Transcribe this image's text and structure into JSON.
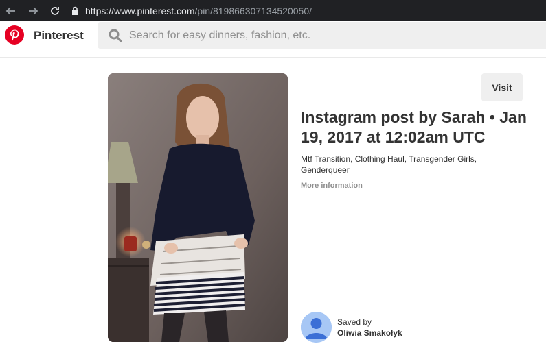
{
  "browser": {
    "url_host": "https://www.pinterest.com",
    "url_path": "/pin/819866307134520050/"
  },
  "header": {
    "brand": "Pinterest",
    "search_placeholder": "Search for easy dinners, fashion, etc."
  },
  "pin": {
    "visit_label": "Visit",
    "title": "Instagram post by Sarah • Jan 19, 2017 at 12:02am UTC",
    "description": "Mtf Transition, Clothing Haul, Transgender Girls, Genderqueer",
    "more_info_label": "More information",
    "saved_by_label": "Saved by",
    "saved_by_user": "Oliwia Smakołyk"
  },
  "colors": {
    "brand_red": "#e60023",
    "chrome_bg": "#202124",
    "avatar_bg": "#a7c7f5",
    "avatar_fg": "#3b6fd6"
  }
}
